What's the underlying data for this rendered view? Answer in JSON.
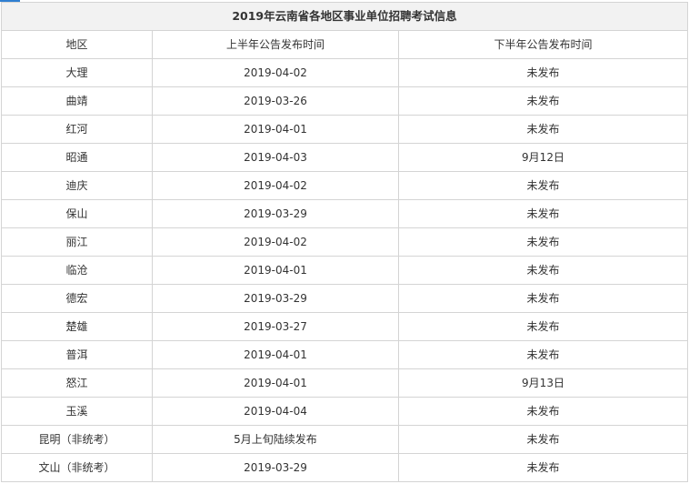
{
  "table": {
    "title": "2019年云南省各地区事业单位招聘考试信息",
    "headers": [
      "地区",
      "上半年公告发布时间",
      "下半年公告发布时间"
    ],
    "rows": [
      [
        "大理",
        "2019-04-02",
        "未发布"
      ],
      [
        "曲靖",
        "2019-03-26",
        "未发布"
      ],
      [
        "红河",
        "2019-04-01",
        "未发布"
      ],
      [
        "昭通",
        "2019-04-03",
        "9月12日"
      ],
      [
        "迪庆",
        "2019-04-02",
        "未发布"
      ],
      [
        "保山",
        "2019-03-29",
        "未发布"
      ],
      [
        "丽江",
        "2019-04-02",
        "未发布"
      ],
      [
        "临沧",
        "2019-04-01",
        "未发布"
      ],
      [
        "德宏",
        "2019-03-29",
        "未发布"
      ],
      [
        "楚雄",
        "2019-03-27",
        "未发布"
      ],
      [
        "普洱",
        "2019-04-01",
        "未发布"
      ],
      [
        "怒江",
        "2019-04-01",
        "9月13日"
      ],
      [
        "玉溪",
        "2019-04-04",
        "未发布"
      ],
      [
        "昆明（非统考）",
        "5月上旬陆续发布",
        "未发布"
      ],
      [
        "文山（非统考）",
        "2019-03-29",
        "未发布"
      ]
    ]
  },
  "colors": {
    "title_background": "#f2f2f2",
    "border": "#d4d4d4",
    "text": "#333333",
    "accent": "#2f7fd1"
  }
}
